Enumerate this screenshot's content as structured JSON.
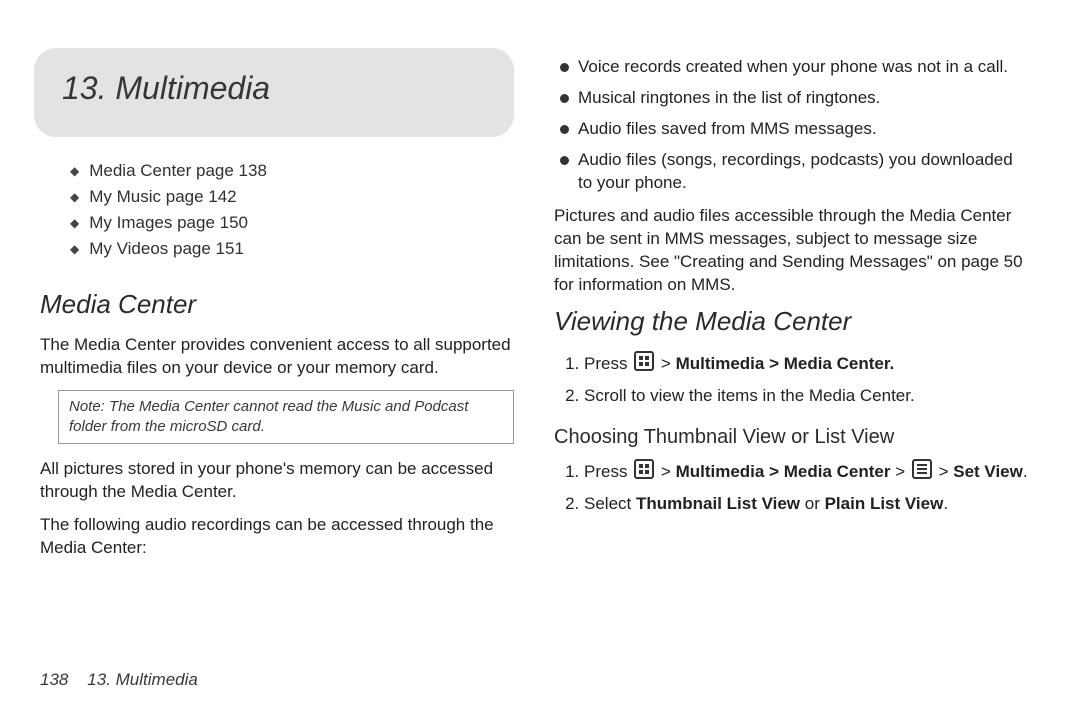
{
  "chapter": {
    "title": "13. Multimedia"
  },
  "toc": [
    "Media Center page 138",
    "My Music page 142",
    "My Images page 150",
    "My Videos page 151"
  ],
  "media_center": {
    "heading": "Media Center",
    "intro": "The Media Center provides convenient access to all supported multimedia files on your device or your memory card.",
    "note_label": "Note:",
    "note_text": "The Media Center cannot read the Music and Podcast folder from the microSD card.",
    "pictures": "All pictures stored in your phone's memory can be accessed through the Media Center.",
    "audio_intro": "The following audio recordings can be accessed through the Media Center:",
    "audio_items": [
      "Voice records created when your phone was not in a call.",
      "Musical ringtones in the list of ringtones.",
      "Audio files saved from MMS messages.",
      "Audio files (songs, recordings, podcasts) you downloaded to your phone."
    ],
    "mms_note": "Pictures and audio files accessible through the Media Center can be sent in MMS messages, subject to message size limitations. See \"Creating and Sending Messages\" on page 50 for information on MMS."
  },
  "viewing": {
    "heading": "Viewing the Media Center",
    "step1_prefix": "Press ",
    "step1_suffix": "Multimedia > Media Center.",
    "step2": "Scroll to view the items in the Media Center."
  },
  "choosing": {
    "heading": "Choosing Thumbnail View or List View",
    "step1_prefix": "Press ",
    "step1_mid_a": "Multimedia > Media Center",
    "step1_mid_b": "Set View",
    "step2_a": "Select ",
    "step2_b": "Thumbnail List View",
    "step2_c": " or ",
    "step2_d": "Plain List View",
    "step2_e": "."
  },
  "footer": {
    "page": "138",
    "label": "13. Multimedia"
  }
}
